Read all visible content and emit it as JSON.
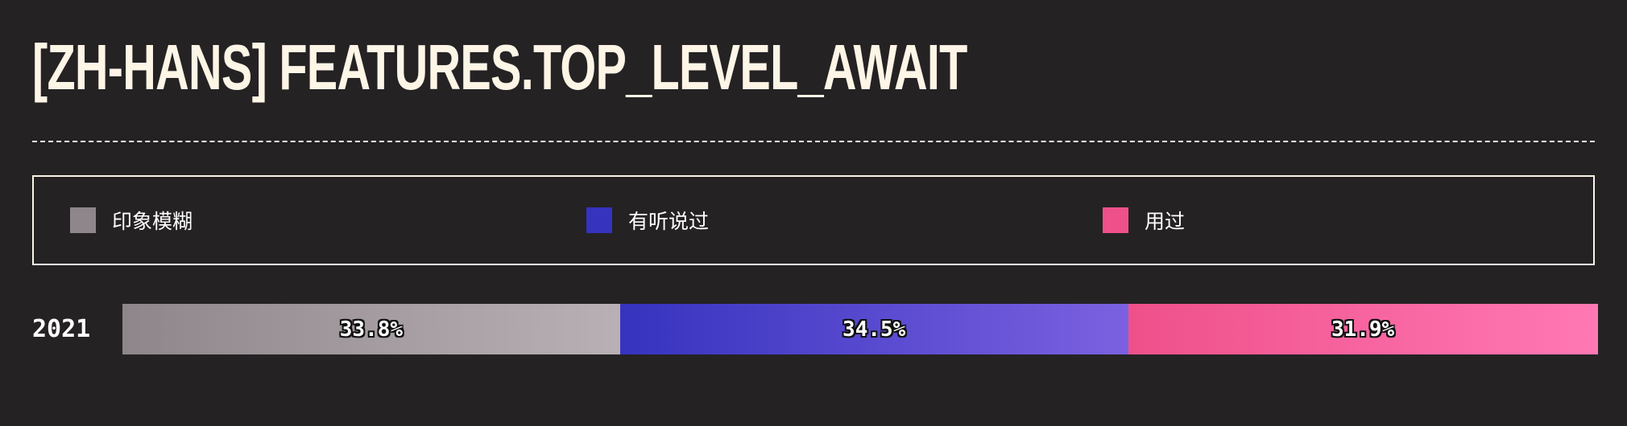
{
  "title": "[ZH-HANS] FEATURES.TOP_LEVEL_AWAIT",
  "legend": {
    "items": [
      {
        "label": "印象模糊",
        "color": "#8e868a"
      },
      {
        "label": "有听说过",
        "color": "#3633bf"
      },
      {
        "label": "用过",
        "color": "#ef508a"
      }
    ]
  },
  "chart_data": {
    "type": "bar",
    "orientation": "horizontal-stacked-100",
    "categories": [
      "2021"
    ],
    "series": [
      {
        "name": "印象模糊",
        "values": [
          33.8
        ],
        "label": "33.8%",
        "color_from": "#8e868a",
        "color_to": "#b8b0b4"
      },
      {
        "name": "有听说过",
        "values": [
          34.5
        ],
        "label": "34.5%",
        "color_from": "#3633bf",
        "color_to": "#7b61e0"
      },
      {
        "name": "用过",
        "values": [
          31.9
        ],
        "label": "31.9%",
        "color_from": "#ef508a",
        "color_to": "#ff78b4"
      }
    ],
    "xlim": [
      0,
      100
    ],
    "legend_position": "top",
    "grid": false
  }
}
